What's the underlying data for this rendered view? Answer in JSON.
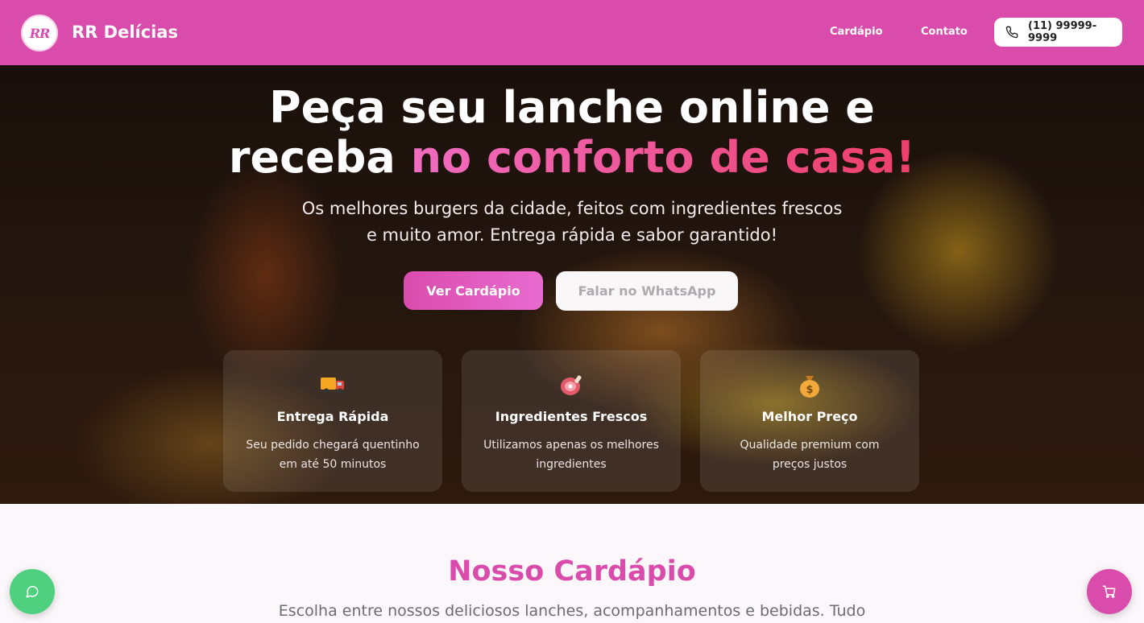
{
  "header": {
    "logo_text": "RR",
    "brand": "RR Delícias",
    "nav": [
      {
        "label": "Cardápio"
      },
      {
        "label": "Contato"
      }
    ],
    "phone": "(11) 99999-9999"
  },
  "hero": {
    "title_line1": "Peça seu lanche online e",
    "title_line2_plain": "receba ",
    "title_line2_accent": "no conforto de casa!",
    "subtitle_line1": "Os melhores burgers da cidade, feitos com ingredientes frescos",
    "subtitle_line2": "e muito amor. Entrega rápida e sabor garantido!",
    "primary_button": "Ver Cardápio",
    "secondary_button": "Falar no WhatsApp",
    "features": [
      {
        "icon": "delivery-truck-icon",
        "title": "Entrega Rápida",
        "desc_line1": "Seu pedido chegará quentinho",
        "desc_line2": "em até 50 minutos"
      },
      {
        "icon": "meat-icon",
        "title": "Ingredientes Frescos",
        "desc_line1": "Utilizamos apenas os melhores",
        "desc_line2": "ingredientes"
      },
      {
        "icon": "money-bag-icon",
        "title": "Melhor Preço",
        "desc_line1": "Qualidade premium com",
        "desc_line2": "preços justos"
      }
    ]
  },
  "menu": {
    "title": "Nosso Cardápio",
    "subtitle": "Escolha entre nossos deliciosos lanches, acompanhamentos e bebidas. Tudo"
  },
  "colors": {
    "brand": "#d94cac",
    "accent_start": "#f06cc0",
    "accent_end": "#ee3f6a",
    "whatsapp": "#4ed07e"
  }
}
